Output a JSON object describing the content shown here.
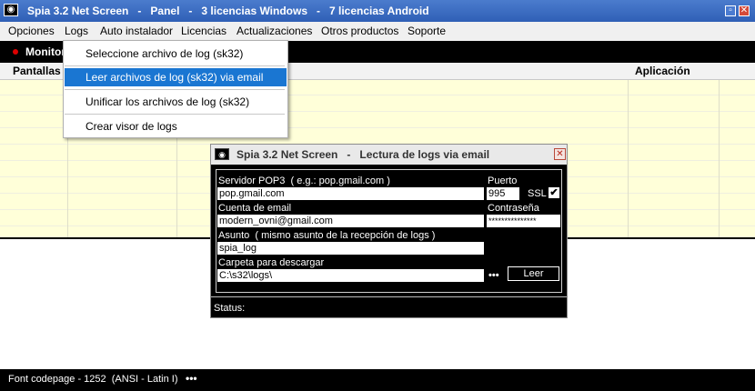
{
  "window": {
    "title": "Spia 3.2 Net Screen   -   Panel   -   3 licencias Windows   -   7 licencias Android",
    "icon": "eye-icon",
    "min_symbol": "▫",
    "close_symbol": "✕"
  },
  "menubar": {
    "items": [
      "Opciones",
      "Logs",
      "Auto instalador",
      "Licencias",
      "Actualizaciones",
      "Otros productos",
      "Soporte"
    ]
  },
  "toolbar": {
    "monitor_label": "Monitor"
  },
  "grid": {
    "columns": [
      "Pantallas",
      "Aplicación"
    ]
  },
  "logs_menu": {
    "items": [
      "Seleccione archivo de log (sk32)",
      "Leer archivos de log (sk32) via email",
      "Unificar los archivos de log (sk32)",
      "Crear visor de logs"
    ],
    "selected_index": 1
  },
  "dialog": {
    "title": "Spia 3.2 Net Screen   -   Lectura de logs via email",
    "close_symbol": "✕",
    "server_label": "Servidor POP3  ( e.g.: pop.gmail.com )",
    "server_value": "pop.gmail.com",
    "port_label": "Puerto",
    "port_value": "995",
    "ssl_label": "SSL",
    "ssl_checked": "✔",
    "account_label": "Cuenta de email",
    "account_value": "modern_ovni@gmail.com",
    "password_label": "Contraseña",
    "password_value": "***************",
    "subject_label": "Asunto  ( mismo asunto de la recepción de logs )",
    "subject_value": "spia_log",
    "folder_label": "Carpeta para descargar",
    "folder_value": "C:\\s32\\logs\\",
    "browse_dots": "•••",
    "read_button": "Leer",
    "status_label": "Status:"
  },
  "statusbar": {
    "text": "Font codepage - 1252  (ANSI - Latin I)",
    "dots": "•••"
  },
  "colors": {
    "titlebar": "#3a6bc4",
    "menu_highlight": "#1a76d2",
    "grid_bg": "#ffffd9",
    "dark_panel": "#000000"
  }
}
